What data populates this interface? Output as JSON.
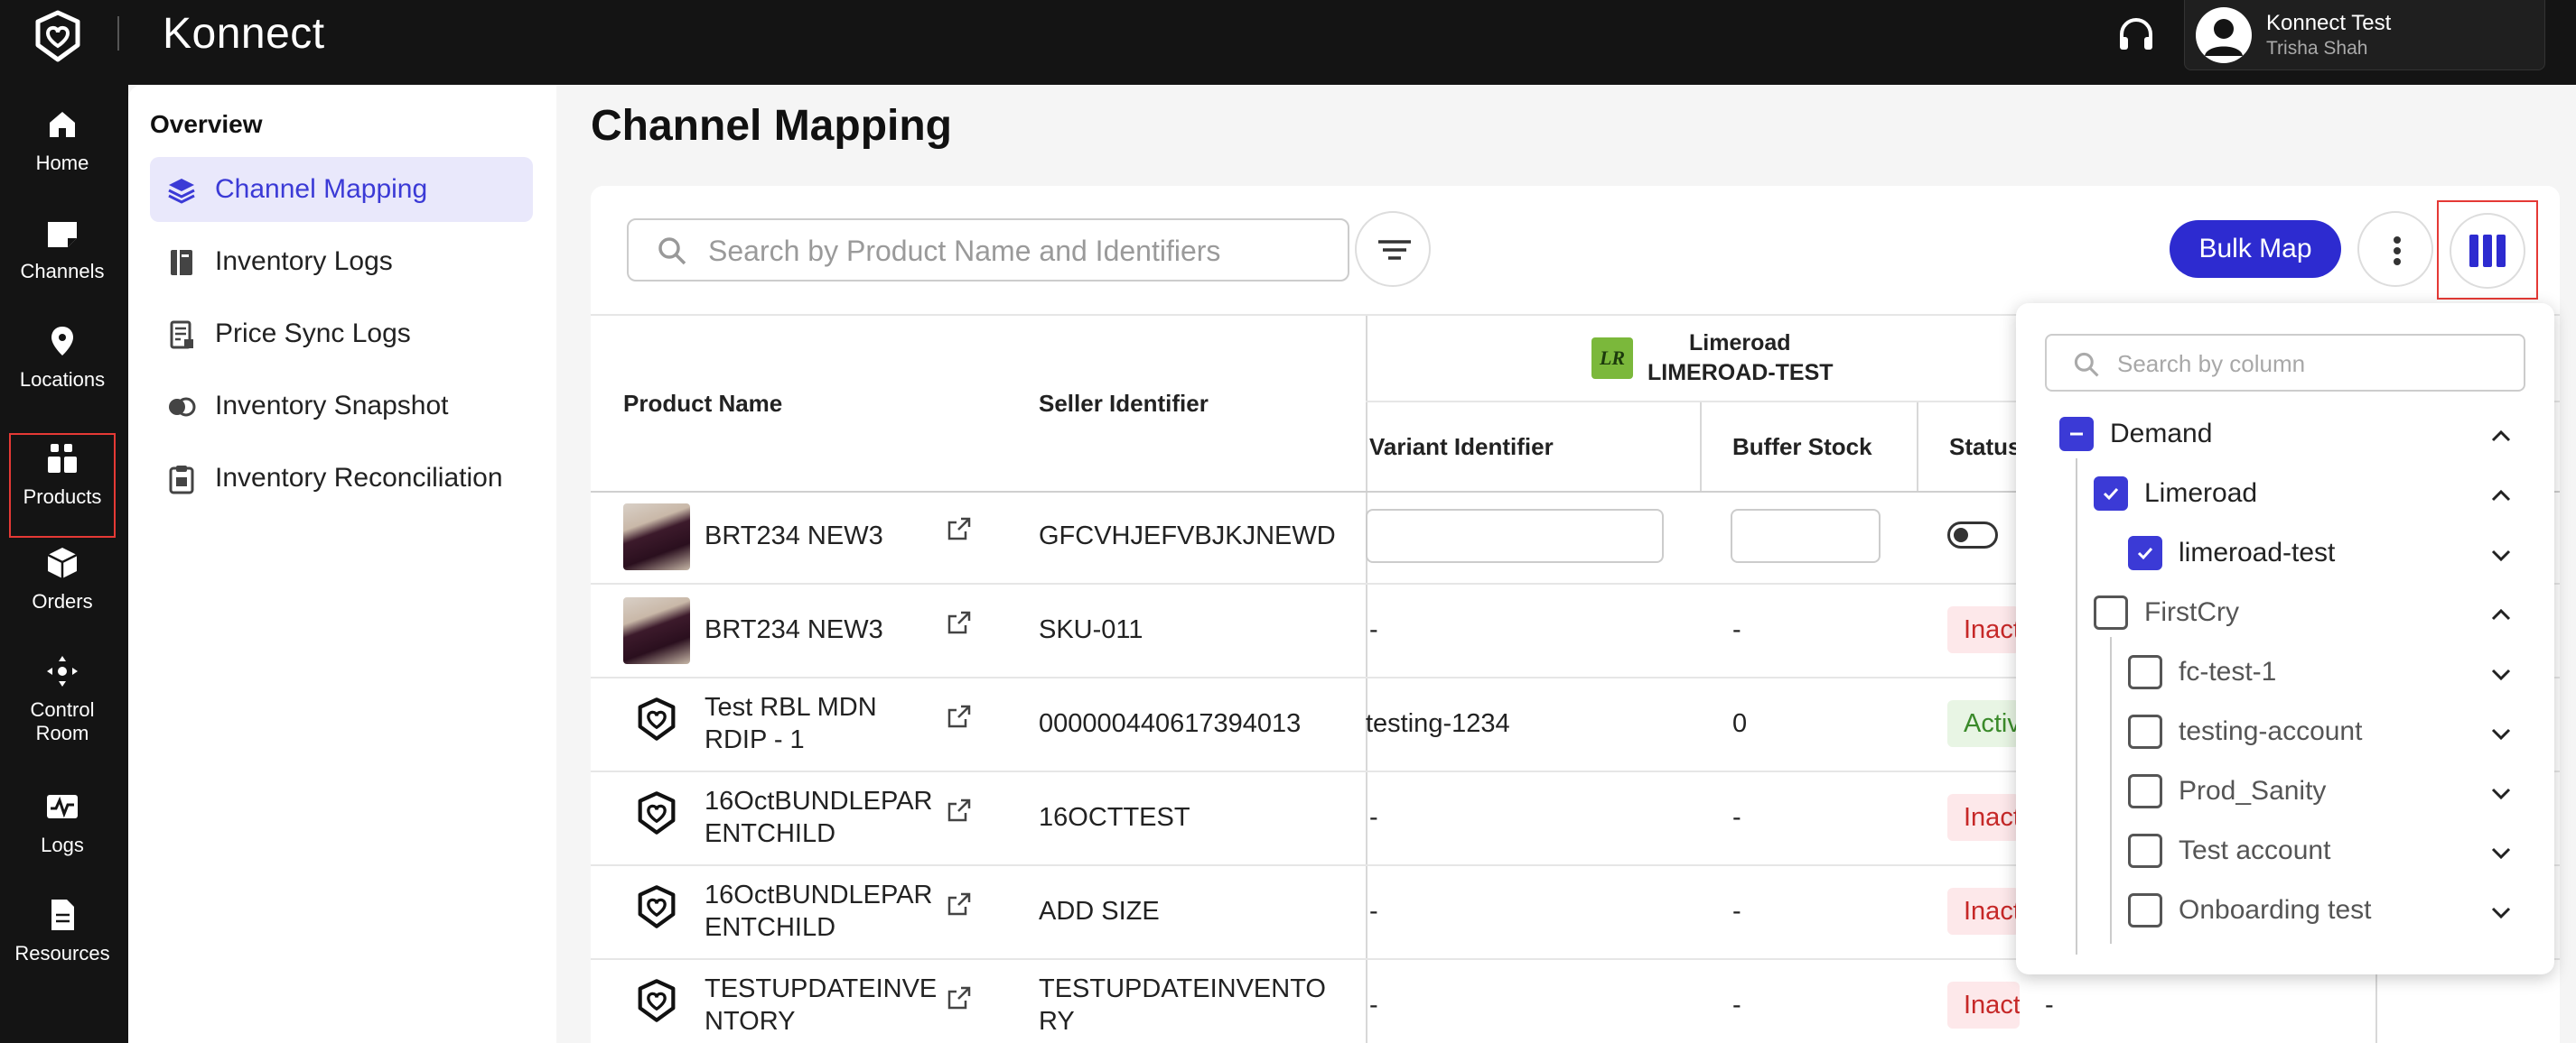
{
  "app": {
    "brand": "Konnect",
    "user_name": "Konnect Test",
    "user_sub": "Trisha Shah"
  },
  "rail": {
    "items": [
      {
        "label": "Home",
        "icon": "home-icon"
      },
      {
        "label": "Channels",
        "icon": "channels-icon"
      },
      {
        "label": "Locations",
        "icon": "location-pin-icon"
      },
      {
        "label": "Products",
        "icon": "products-icon"
      },
      {
        "label": "Orders",
        "icon": "box-icon"
      },
      {
        "label": "Control Room",
        "icon": "control-room-icon"
      },
      {
        "label": "Logs",
        "icon": "logs-icon"
      },
      {
        "label": "Resources",
        "icon": "document-icon"
      }
    ]
  },
  "subnav": {
    "title": "Overview",
    "items": [
      {
        "label": "Channel Mapping",
        "icon": "layers-icon"
      },
      {
        "label": "Inventory Logs",
        "icon": "notebook-icon"
      },
      {
        "label": "Price Sync Logs",
        "icon": "receipt-icon"
      },
      {
        "label": "Inventory Snapshot",
        "icon": "snapshot-icon"
      },
      {
        "label": "Inventory Reconciliation",
        "icon": "clipboard-icon"
      }
    ]
  },
  "main": {
    "title": "Channel Mapping",
    "search_placeholder": "Search by Product Name and Identifiers",
    "bulk_map_label": "Bulk Map"
  },
  "table": {
    "headers": {
      "product_name": "Product Name",
      "seller_identifier": "Seller Identifier",
      "channel_name": "Limeroad",
      "channel_account": "LIMEROAD-TEST",
      "channel_logo_text": "LR",
      "variant_identifier": "Variant Identifier",
      "buffer_stock": "Buffer Stock",
      "status": "Status"
    },
    "rows": [
      {
        "name": "BRT234 NEW3",
        "seller_id": "GFCVHJEFVBJKJNEWD",
        "variant": "",
        "buffer": "",
        "status": "toggle",
        "extra": ""
      },
      {
        "name": "BRT234 NEW3",
        "seller_id": "SKU-011",
        "variant": "-",
        "buffer": "-",
        "status": "Inactive",
        "extra": ""
      },
      {
        "name": "Test RBL MDN RDIP - 1",
        "seller_id": "000000440617394013",
        "variant": "testing-1234",
        "buffer": "0",
        "status": "Active",
        "extra": ""
      },
      {
        "name": "16OctBUNDLEPARENTCHILD",
        "seller_id": "16OCTTEST",
        "variant": "-",
        "buffer": "-",
        "status": "Inactive",
        "extra": ""
      },
      {
        "name": "16OctBUNDLEPARENTCHILD",
        "seller_id": "ADD SIZE",
        "variant": "-",
        "buffer": "-",
        "status": "Inactive",
        "extra": ""
      },
      {
        "name": "TESTUPDATEINVENTORY",
        "seller_id": "TESTUPDATEINVENTORY",
        "variant": "-",
        "buffer": "-",
        "status": "Inactive",
        "extra": "-"
      }
    ]
  },
  "column_chooser": {
    "search_placeholder": "Search by column",
    "tree": [
      {
        "label": "Demand",
        "state": "indeterminate"
      },
      {
        "label": "Limeroad",
        "state": "checked"
      },
      {
        "label": "limeroad-test",
        "state": "checked"
      },
      {
        "label": "FirstCry",
        "state": "unchecked"
      },
      {
        "label": "fc-test-1",
        "state": "unchecked"
      },
      {
        "label": "testing-account",
        "state": "unchecked"
      },
      {
        "label": "Prod_Sanity",
        "state": "unchecked"
      },
      {
        "label": "Test account",
        "state": "unchecked"
      },
      {
        "label": "Onboarding test",
        "state": "unchecked"
      }
    ]
  },
  "colors": {
    "accent": "#3b3ad6",
    "bulk_button": "#2d2bd0",
    "nav_bg": "#141414",
    "inactive_text": "#c62828",
    "active_text": "#3a8a2a"
  }
}
